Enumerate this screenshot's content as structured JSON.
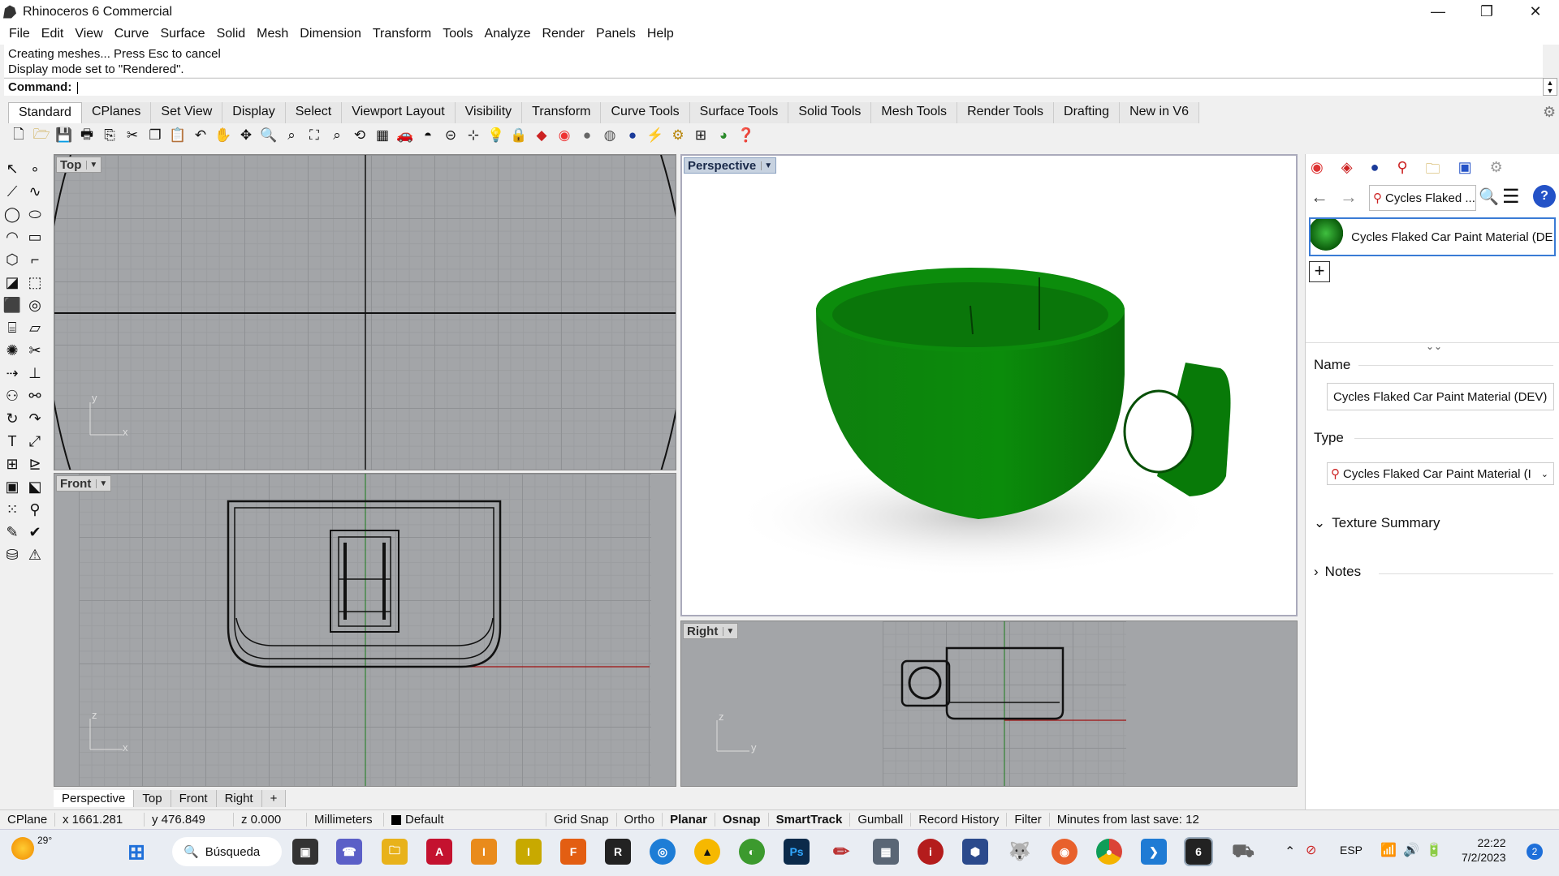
{
  "app": {
    "title": "Rhinoceros 6 Commercial"
  },
  "window_controls": {
    "minimize": "—",
    "restore": "❐",
    "close": "✕"
  },
  "menu": [
    "File",
    "Edit",
    "View",
    "Curve",
    "Surface",
    "Solid",
    "Mesh",
    "Dimension",
    "Transform",
    "Tools",
    "Analyze",
    "Render",
    "Panels",
    "Help"
  ],
  "command": {
    "history": [
      "Creating meshes... Press Esc to cancel",
      "Display mode set to \"Rendered\"."
    ],
    "prompt": "Command:"
  },
  "toolbar_tabs": [
    "Standard",
    "CPlanes",
    "Set View",
    "Display",
    "Select",
    "Viewport Layout",
    "Visibility",
    "Transform",
    "Curve Tools",
    "Surface Tools",
    "Solid Tools",
    "Mesh Tools",
    "Render Tools",
    "Drafting",
    "New in V6"
  ],
  "toolbar_icons": [
    "new-icon",
    "open-icon",
    "save-icon",
    "print-icon",
    "import-icon",
    "cut-icon",
    "copy-icon",
    "paste-icon",
    "undo-icon",
    "pan-icon",
    "rotate-view-icon",
    "zoom-icon",
    "zoom-window-icon",
    "zoom-extents-icon",
    "zoom-selected-icon",
    "undo-view-icon",
    "viewport-layout-icon",
    "car-icon",
    "shade-icon",
    "cplane-icon",
    "snap-icon",
    "light-icon",
    "lock-icon",
    "material-icon",
    "color-wheel-icon",
    "sphere-icon",
    "render-sphere-icon",
    "blue-sphere-icon",
    "flash-icon",
    "gears-icon",
    "grid-icon",
    "render-icon",
    "help-icon"
  ],
  "viewports": {
    "top": {
      "label": "Top",
      "axis_a": "y",
      "axis_b": "x"
    },
    "front": {
      "label": "Front",
      "axis_a": "z",
      "axis_b": "x"
    },
    "perspective": {
      "label": "Perspective"
    },
    "right": {
      "label": "Right",
      "axis_a": "z",
      "axis_b": "y"
    }
  },
  "viewport_tabs": [
    "Perspective",
    "Top",
    "Front",
    "Right",
    "+"
  ],
  "status": {
    "cplane": "CPlane",
    "x": "x 1661.281",
    "y": "y 476.849",
    "z": "z 0.000",
    "units": "Millimeters",
    "layer": "Default",
    "toggles": [
      {
        "label": "Grid Snap",
        "on": false
      },
      {
        "label": "Ortho",
        "on": false
      },
      {
        "label": "Planar",
        "on": true
      },
      {
        "label": "Osnap",
        "on": true
      },
      {
        "label": "SmartTrack",
        "on": true
      },
      {
        "label": "Gumball",
        "on": false
      },
      {
        "label": "Record History",
        "on": false
      },
      {
        "label": "Filter",
        "on": false
      }
    ],
    "save_info": "Minutes from last save: 12"
  },
  "panel": {
    "icons": [
      "color-icon",
      "layers-icon",
      "render-content-icon",
      "materials-icon",
      "folder-icon",
      "display-icon",
      "settings-icon"
    ],
    "search_text": "Cycles Flaked ...",
    "material_item": "Cycles Flaked Car Paint Material (DE...",
    "name_label": "Name",
    "name_value": "Cycles Flaked Car Paint Material (DEV)",
    "type_label": "Type",
    "type_value": "Cycles Flaked Car Paint Material (I",
    "texture_summary": "Texture Summary",
    "notes": "Notes",
    "accent": "#0a7d0a"
  },
  "taskbar": {
    "weather": "29°",
    "search": "Búsqueda",
    "lang": "ESP",
    "time": "22:22",
    "date": "7/2/2023",
    "notif_count": "2"
  }
}
